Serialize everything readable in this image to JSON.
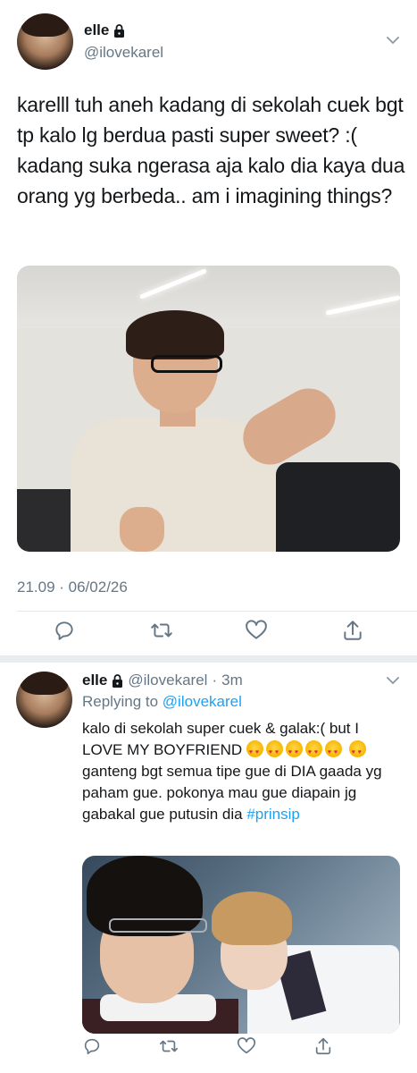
{
  "main_tweet": {
    "display_name": "elle",
    "handle": "@ilovekarel",
    "text": "karelll tuh aneh kadang di sekolah cuek bgt tp kalo lg berdua pasti super sweet? :( kadang suka ngerasa aja kalo dia kaya dua orang yg berbeda.. am i imagining things?",
    "timestamp": "21.09 · 06/02/26",
    "icons": {
      "lock": "lock-icon",
      "more": "chevron-down-icon",
      "reply": "reply-icon",
      "retweet": "retweet-icon",
      "like": "heart-icon",
      "share": "share-icon"
    }
  },
  "reply_tweet": {
    "display_name": "elle",
    "handle": "@ilovekarel",
    "time_separator": "·",
    "time": "3m",
    "replying_prefix": "Replying to",
    "replying_to": "@ilovekarel",
    "text_part1": "kalo di sekolah super cuek & galak:( but I LOVE MY BOYFRIEND",
    "text_part2": "ganteng bgt semua tipe gue di DIA gaada yg paham gue. pokonya mau gue diapain jg gabakal gue putusin dia",
    "hashtag": "#prinsip",
    "emoji": "smiling-face-with-heart-eyes",
    "emoji_count_line1": 5,
    "emoji_count_line2": 1
  },
  "colors": {
    "text": "#14171a",
    "secondary": "#657786",
    "link": "#1da1f2",
    "divider": "#e1e8ed"
  }
}
